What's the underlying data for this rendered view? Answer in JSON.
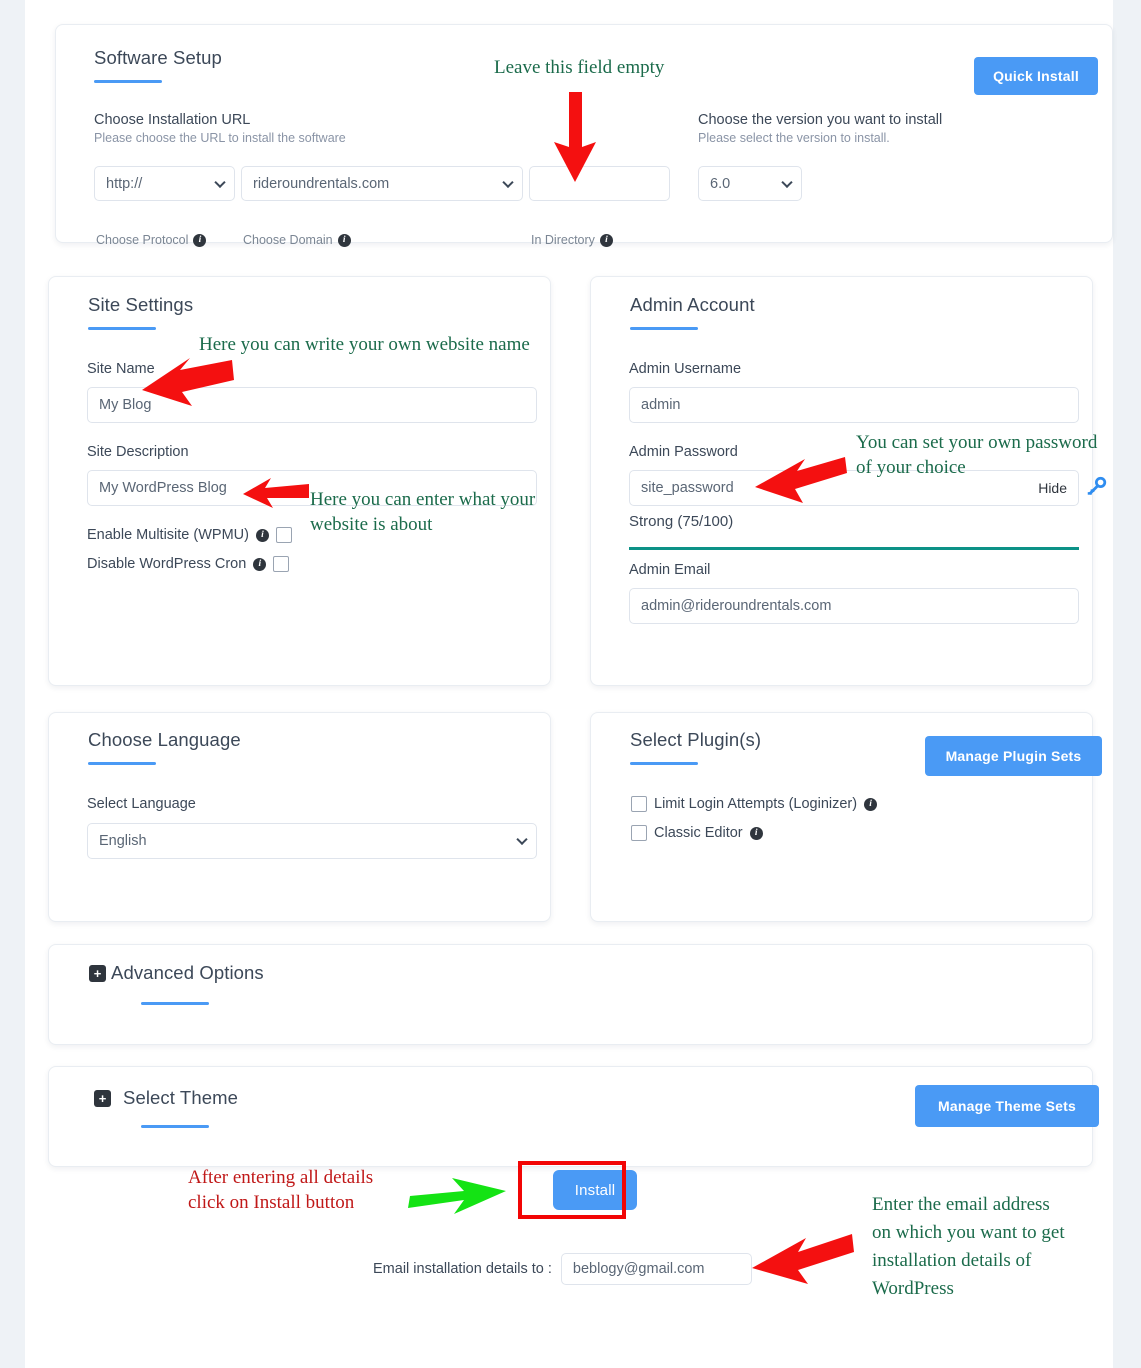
{
  "software_setup": {
    "title": "Software Setup",
    "quick_install_label": "Quick Install",
    "install_url": {
      "label": "Choose Installation URL",
      "sub": "Please choose the URL to install the software",
      "protocol_value": "http://",
      "protocol_hint": "Choose Protocol",
      "domain_value": "rideroundrentals.com",
      "domain_hint": "Choose Domain",
      "directory_value": "",
      "directory_hint": "In Directory"
    },
    "version": {
      "label": "Choose the version you want to install",
      "sub": "Please select the version to install.",
      "value": "6.0"
    }
  },
  "site_settings": {
    "title": "Site Settings",
    "site_name_label": "Site Name",
    "site_name_value": "My Blog",
    "site_desc_label": "Site Description",
    "site_desc_value": "My WordPress Blog",
    "multisite_label": "Enable Multisite (WPMU)",
    "cron_label": "Disable WordPress Cron"
  },
  "admin_account": {
    "title": "Admin Account",
    "username_label": "Admin Username",
    "username_value": "admin",
    "password_label": "Admin Password",
    "password_value": "site_password",
    "hide_label": "Hide",
    "strength_text": "Strong (75/100)",
    "strength_percent": 75,
    "strength_color": "#0c9287",
    "email_label": "Admin Email",
    "email_value": "admin@rideroundrentals.com"
  },
  "language": {
    "title": "Choose Language",
    "select_label": "Select Language",
    "value": "English"
  },
  "plugins": {
    "title": "Select Plugin(s)",
    "manage_label": "Manage Plugin Sets",
    "items": [
      {
        "label": "Limit Login Attempts (Loginizer)",
        "checked": false
      },
      {
        "label": "Classic Editor",
        "checked": false
      }
    ]
  },
  "advanced_options": {
    "title": "Advanced Options"
  },
  "select_theme": {
    "title": "Select Theme",
    "manage_label": "Manage Theme Sets"
  },
  "footer": {
    "install_label": "Install",
    "email_to_label": "Email installation details to :",
    "email_to_value": "beblogy@gmail.com"
  },
  "annotations": {
    "leave_empty": "Leave this field empty",
    "site_name_note": "Here you can write your own website name",
    "site_desc_note_l1": "Here you can enter what your",
    "site_desc_note_l2": "website is about",
    "password_note_l1": "You can set your own password",
    "password_note_l2": "of your choice",
    "install_note_l1": "After entering all details",
    "install_note_l2": "click on Install button",
    "email_note_l1": "Enter the email address",
    "email_note_l2": "on which you want to get",
    "email_note_l3": "installation details of",
    "email_note_l4": "WordPress"
  },
  "colors": {
    "accent_blue": "#4a9af5",
    "annotation_green": "#1b6b4b",
    "annotation_red": "#c01818",
    "highlight_red": "#f20505",
    "arrow_green": "#14e314",
    "page_bg": "#eef2f6"
  }
}
